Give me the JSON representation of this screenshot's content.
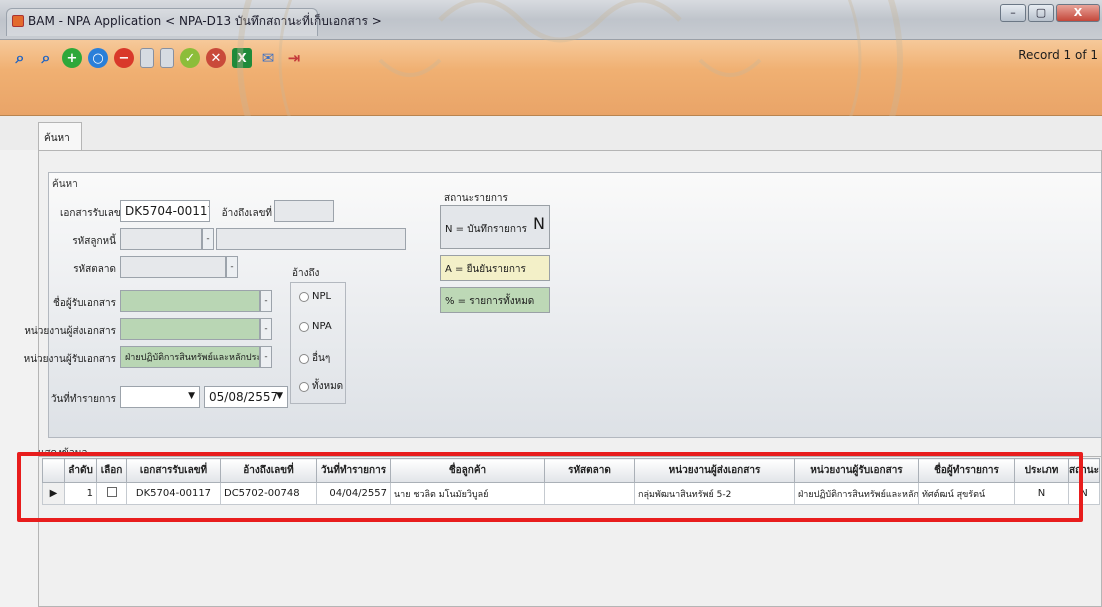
{
  "window": {
    "title": "BAM - NPA Application < NPA-D13 บันทึกสถานะที่เก็บเอกสาร >",
    "record_info": "Record 1 of 1",
    "btn_min": "–",
    "btn_max": "▢",
    "btn_close": "X"
  },
  "toolbar_icons": [
    "search-icon",
    "search-plus-icon",
    "add-icon",
    "refresh-icon",
    "delete-icon",
    "save-icon",
    "attach-icon",
    "approve-icon",
    "cancel-icon",
    "excel-icon",
    "mail-icon",
    "exit-icon"
  ],
  "tab": {
    "label": "ค้นหารายการ"
  },
  "search": {
    "group_title": "ค้นหา",
    "doc_no_label": "เอกสารรับเลขที่",
    "doc_no_value": "DK5704-00117",
    "ref_no_label": "อ้างถึงเลขที่",
    "ref_no_value": "",
    "customer_code_label": "รหัสลูกหนี้",
    "market_code_label": "รหัสตลาด",
    "receiver_name_label": "ชื่อผู้รับเอกสาร",
    "sender_unit_label": "หน่วยงานผู้ส่งเอกสาร",
    "receiver_unit_label": "หน่วยงานผู้รับเอกสาร",
    "receiver_unit_value": "ฝ่ายปฏิบัติการสินทรัพย์และหลักประกัน",
    "date_label": "วันที่ทำรายการ",
    "date_to": "05/08/2557",
    "ref_group_label": "อ้างถึง",
    "ref_options": [
      "NPL",
      "NPA",
      "อื่นๆ",
      "ทั้งหมด"
    ]
  },
  "status": {
    "title": "สถานะรายการ",
    "value": "N",
    "items": [
      "N = บันทึกรายการ",
      "A = ยืนยันรายการ",
      "% = รายการทั้งหมด"
    ]
  },
  "grid": {
    "title": "แสดงข้อมูล",
    "columns": [
      "ลำดับ",
      "เลือก",
      "เอกสารรับเลขที่",
      "อ้างถึงเลขที่",
      "วันที่ทำรายการ",
      "ชื่อลูกค้า",
      "รหัสตลาด",
      "หน่วยงานผู้ส่งเอกสาร",
      "หน่วยงานผู้รับเอกสาร",
      "ชื่อผู้ทำรายการ",
      "ประเภท",
      "สถานะ"
    ],
    "rows": [
      [
        "1",
        "",
        "DK5704-00117",
        "DC5702-00748",
        "04/04/2557",
        "นาย ชวลิต มโนมัยวิบูลย์",
        "",
        "กลุ่มพัฒนาสินทรัพย์ 5-2",
        "ฝ่ายปฏิบัติการสินทรัพย์และหลักประกัน",
        "ทัศต์ฒน์ สุขรัตน์",
        "N",
        "N"
      ]
    ]
  }
}
